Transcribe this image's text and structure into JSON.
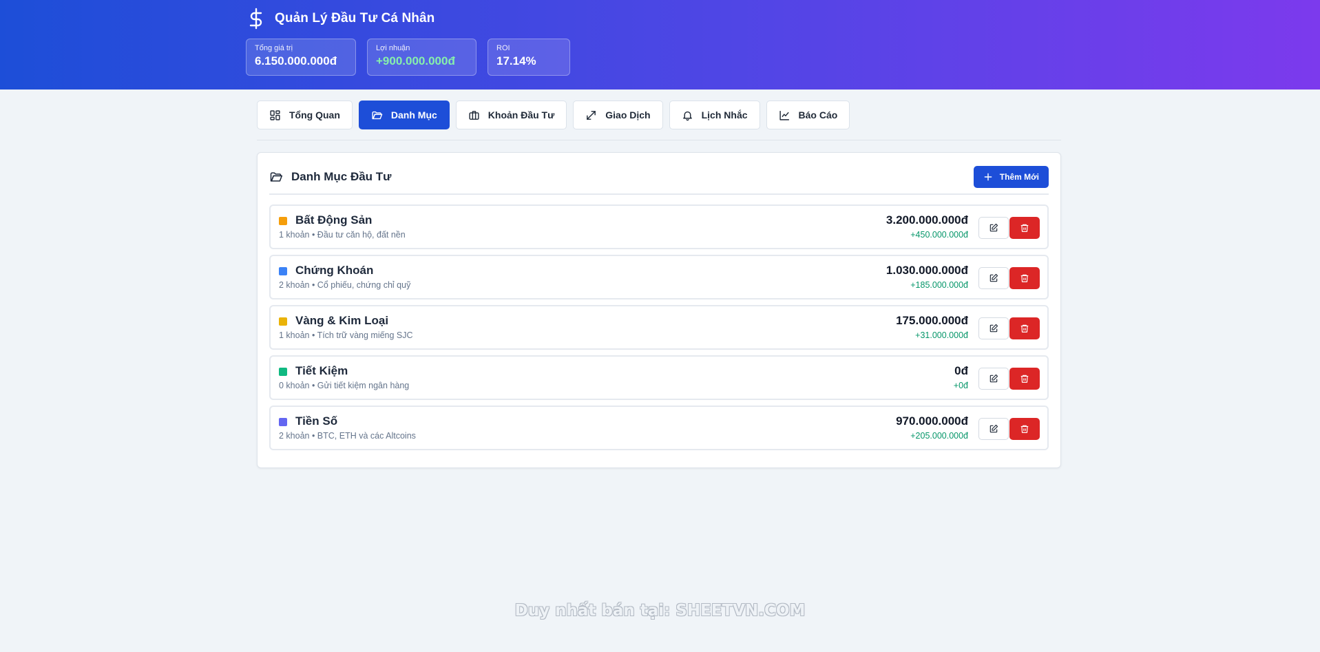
{
  "header": {
    "title": "Quản Lý Đầu Tư Cá Nhân",
    "icon": "dollar-icon",
    "stats": [
      {
        "label": "Tổng giá trị",
        "value": "6.150.000.000đ",
        "positive": false
      },
      {
        "label": "Lợi nhuận",
        "value": "+900.000.000đ",
        "positive": true
      },
      {
        "label": "ROI",
        "value": "17.14%",
        "positive": false
      }
    ]
  },
  "tabs": [
    {
      "label": "Tổng Quan",
      "icon": "dashboard-icon",
      "active": false
    },
    {
      "label": "Danh Mục",
      "icon": "folder-icon",
      "active": true
    },
    {
      "label": "Khoản Đầu Tư",
      "icon": "briefcase-icon",
      "active": false
    },
    {
      "label": "Giao Dịch",
      "icon": "arrows-icon",
      "active": false
    },
    {
      "label": "Lịch Nhắc",
      "icon": "bell-icon",
      "active": false
    },
    {
      "label": "Báo Cáo",
      "icon": "chart-icon",
      "active": false
    }
  ],
  "panel": {
    "title": "Danh Mục Đầu Tư",
    "add_label": "Thêm Mới"
  },
  "categories": [
    {
      "name": "Bất Động Sản",
      "meta": "1 khoản • Đầu tư căn hộ, đất nền",
      "amount": "3.200.000.000đ",
      "gain": "+450.000.000đ",
      "color": "#f59e0b"
    },
    {
      "name": "Chứng Khoán",
      "meta": "2 khoản • Cổ phiếu, chứng chỉ quỹ",
      "amount": "1.030.000.000đ",
      "gain": "+185.000.000đ",
      "color": "#3b82f6"
    },
    {
      "name": "Vàng & Kim Loại",
      "meta": "1 khoản • Tích trữ vàng miếng SJC",
      "amount": "175.000.000đ",
      "gain": "+31.000.000đ",
      "color": "#eab308"
    },
    {
      "name": "Tiết Kiệm",
      "meta": "0 khoản • Gửi tiết kiệm ngân hàng",
      "amount": "0đ",
      "gain": "+0đ",
      "color": "#10b981"
    },
    {
      "name": "Tiền Số",
      "meta": "2 khoản • BTC, ETH và các Altcoins",
      "amount": "970.000.000đ",
      "gain": "+205.000.000đ",
      "color": "#6366f1"
    }
  ],
  "watermark": "Duy nhất bán tại: SHEETVN.COM"
}
